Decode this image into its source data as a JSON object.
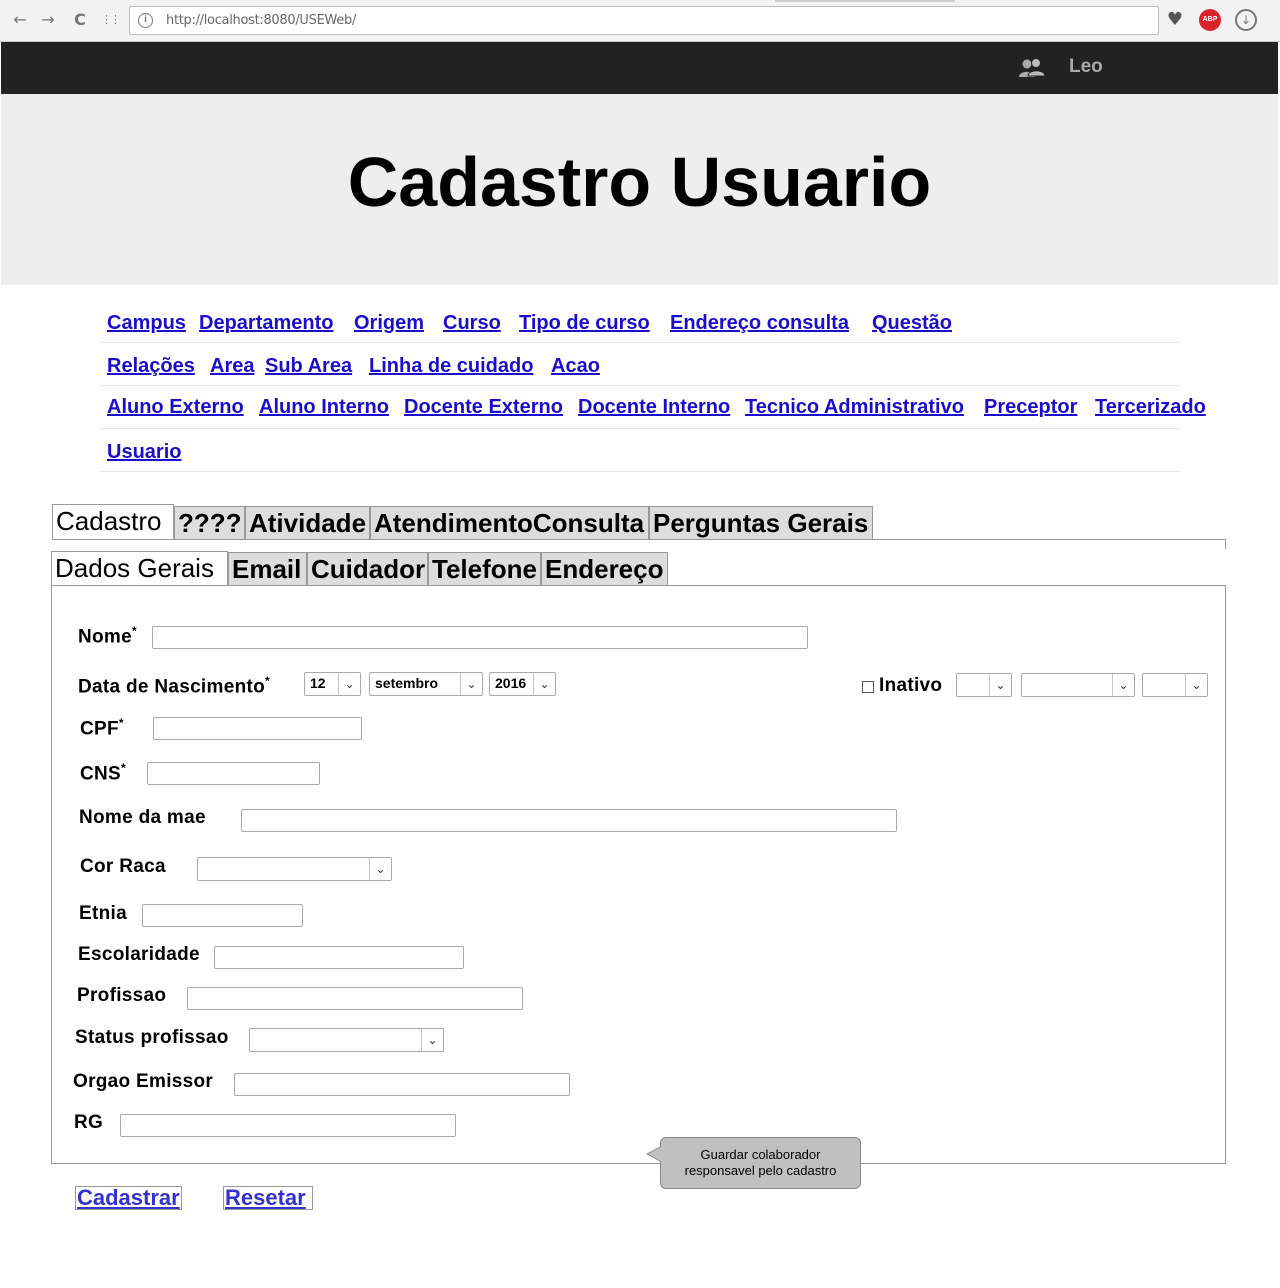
{
  "browser": {
    "url": "http://localhost:8080/USEWeb/",
    "back_glyph": "←",
    "forward_glyph": "→",
    "reload_glyph": "C",
    "apps_glyph": "⋮⋮",
    "info_glyph": "i",
    "heart_glyph": "♥",
    "abp_label": "ABP",
    "download_glyph": "↓"
  },
  "topbar": {
    "username": "Leo",
    "icon": "users-icon"
  },
  "header": {
    "title": "Cadastro Usuario"
  },
  "menu": {
    "rows": [
      [
        "Campus",
        "Departamento",
        "Origem",
        "Curso",
        "Tipo de curso",
        "Endereço consulta",
        "Questão"
      ],
      [
        "Relações",
        "Area",
        "Sub Area",
        "Linha de cuidado",
        "Acao"
      ],
      [
        "Aluno Externo",
        "Aluno Interno",
        "Docente Externo",
        "Docente Interno",
        "Tecnico Administrativo",
        "Preceptor",
        "Tercerizado"
      ],
      [
        "Usuario"
      ]
    ]
  },
  "tabs": {
    "main": [
      "Cadastro",
      "????",
      "Atividade",
      "AtendimentoConsulta",
      "Perguntas Gerais"
    ],
    "sub": [
      "Dados Gerais",
      "Email",
      "Cuidador",
      "Telefone",
      "Endereço"
    ]
  },
  "form": {
    "required_mark": "*",
    "nome_label": "Nome",
    "nome_value": "",
    "nascimento_label": "Data de Nascimento",
    "nascimento_day": "12",
    "nascimento_month": "setembro",
    "nascimento_year": "2016",
    "inativo_label": "Inativo",
    "inativo_checked": false,
    "inativo_day": "",
    "inativo_month": "",
    "inativo_year": "",
    "cpf_label": "CPF",
    "cns_label": "CNS",
    "mae_label": "Nome da mae",
    "cor_raca_label": "Cor Raca",
    "cor_raca_value": "",
    "etnia_label": "Etnia",
    "escolaridade_label": "Escolaridade",
    "profissao_label": "Profissao",
    "status_profissao_label": "Status profissao",
    "status_profissao_value": "",
    "orgao_label": "Orgao Emissor",
    "rg_label": "RG",
    "select_arrow": "⌄"
  },
  "tooltip": {
    "line1": "Guardar colaborador",
    "line2": "responsavel pelo cadastro"
  },
  "buttons": {
    "submit": "Cadastrar",
    "reset": "Resetar"
  }
}
